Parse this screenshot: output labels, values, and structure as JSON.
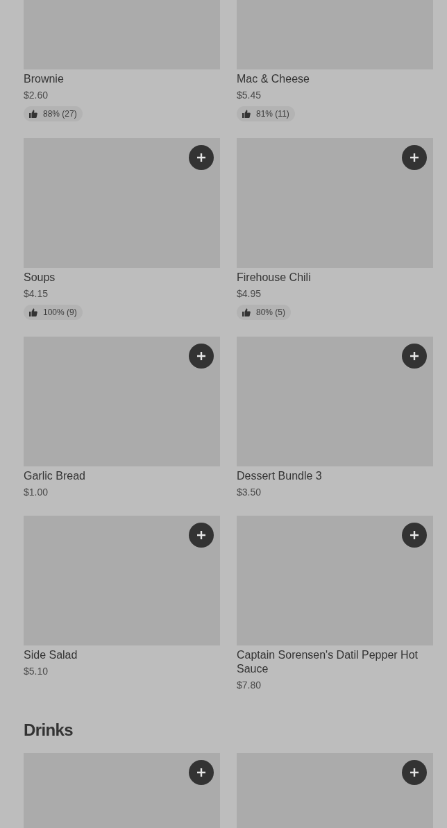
{
  "sections": [
    {
      "items": [
        {
          "name": "Brownie",
          "price": "$2.60",
          "rating": "88% (27)"
        },
        {
          "name": "Mac & Cheese",
          "price": "$5.45",
          "rating": "81% (11)"
        },
        {
          "name": "Soups",
          "price": "$4.15",
          "rating": "100% (9)",
          "add_button": true
        },
        {
          "name": "Firehouse Chili",
          "price": "$4.95",
          "rating": "80% (5)",
          "add_button": true
        },
        {
          "name": "Garlic Bread",
          "price": "$1.00",
          "add_button": true
        },
        {
          "name": "Dessert Bundle 3",
          "price": "$3.50",
          "add_button": true
        },
        {
          "name": "Side Salad",
          "price": "$5.10",
          "add_button": true
        },
        {
          "name": "Captain Sorensen's Datil Pepper Hot Sauce",
          "price": "$7.80",
          "add_button": true
        }
      ]
    },
    {
      "heading": "Drinks",
      "items": [
        {
          "add_button": true
        },
        {
          "add_button": true
        }
      ]
    }
  ]
}
